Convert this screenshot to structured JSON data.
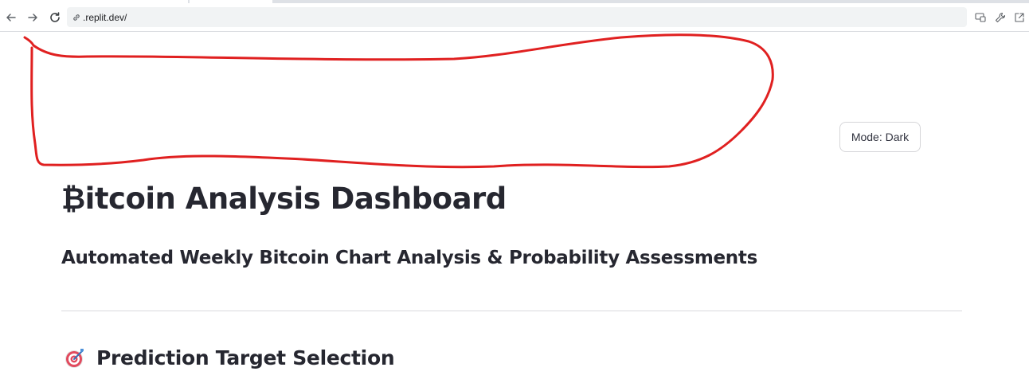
{
  "browser": {
    "url": ".replit.dev/"
  },
  "header": {
    "mode_button": "Mode: Dark"
  },
  "main": {
    "title": "₿itcoin Analysis Dashboard",
    "subtitle": "Automated Weekly Bitcoin Chart Analysis & Probability Assessments",
    "section_title": "Prediction Target Selection"
  },
  "icons": {
    "back": "arrow-left-icon",
    "forward": "arrow-right-icon",
    "reload": "reload-icon",
    "site_info": "link-icon",
    "cast": "cast-icon",
    "devtools": "wrench-icon",
    "open_new": "external-link-icon",
    "section": "target-icon"
  },
  "colors": {
    "annotation_stroke": "#e02020",
    "text_dark": "#262730"
  }
}
